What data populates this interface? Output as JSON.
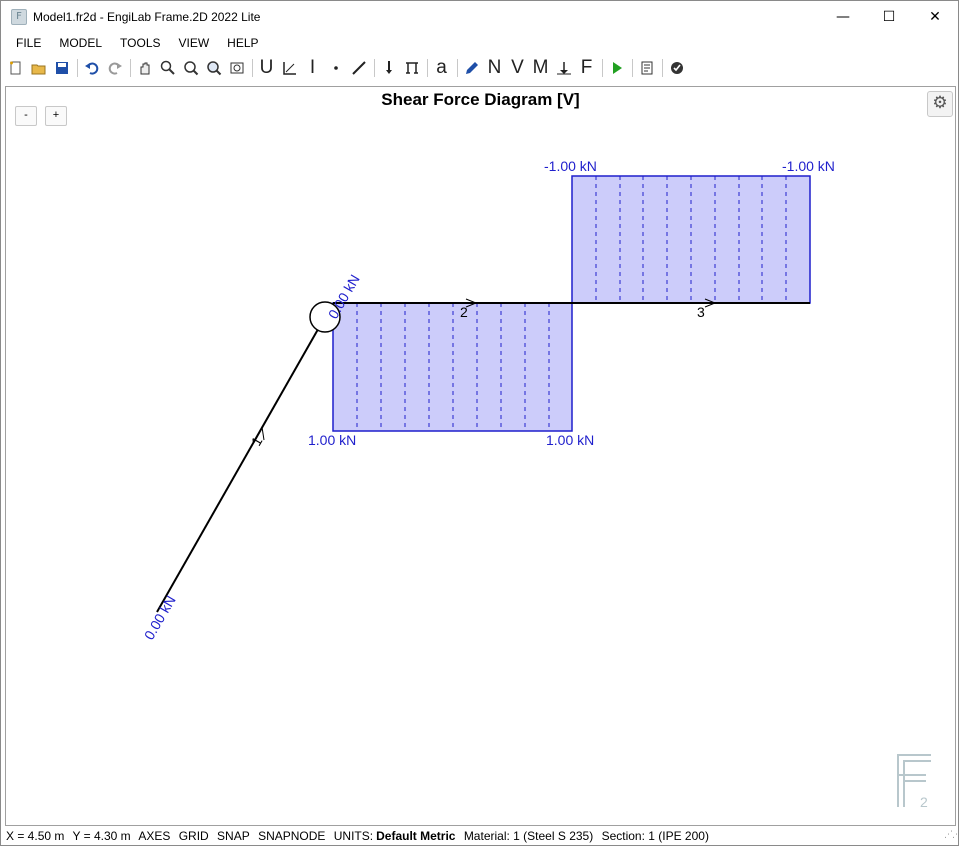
{
  "window": {
    "title": "Model1.fr2d - EngiLab Frame.2D 2022 Lite",
    "app_icon": "F",
    "minimize": "—",
    "maximize": "☐",
    "close": "✕"
  },
  "menu": [
    "FILE",
    "MODEL",
    "TOOLS",
    "VIEW",
    "HELP"
  ],
  "toolbar": {
    "icons": [
      "new-file-icon",
      "open-folder-icon",
      "save-icon",
      "undo-icon",
      "redo-icon",
      "pan-icon",
      "zoom-in-icon",
      "zoom-extents-icon",
      "zoom-window-icon",
      "zoom-previous-icon",
      "units-icon",
      "axes-icon",
      "section-icon",
      "node-icon",
      "line-icon",
      "load-icon",
      "support-icon",
      "label-icon",
      "pencil-icon",
      "axial-force-icon",
      "shear-force-icon",
      "bending-moment-icon",
      "reactions-icon",
      "forces-icon",
      "run-icon",
      "report-icon",
      "check-icon"
    ],
    "glyphs": {
      "units": "U",
      "section": "I",
      "label": "a",
      "axial": "N",
      "shear": "V",
      "moment": "M",
      "forces": "F"
    }
  },
  "canvas": {
    "title": "Shear Force Diagram [V]",
    "zoom_out": "-",
    "zoom_in": "+",
    "settings": "⚙"
  },
  "diagram": {
    "fill_color": "#ccccfa",
    "stroke_color": "#1f1fcc",
    "member_color": "#000000",
    "members": [
      {
        "id": "1",
        "label": "1"
      },
      {
        "id": "2",
        "label": "2"
      },
      {
        "id": "3",
        "label": "3"
      }
    ],
    "labels": {
      "m1_start": "0.00 kN",
      "m1_end": "0.00 kN",
      "m2_start": "1.00 kN",
      "m2_end": "1.00 kN",
      "m3_start": "-1.00 kN",
      "m3_end": "-1.00 kN"
    },
    "shear_values": [
      {
        "member": "1",
        "start": 0.0,
        "end": 0.0
      },
      {
        "member": "2",
        "start": 1.0,
        "end": 1.0
      },
      {
        "member": "3",
        "start": -1.0,
        "end": -1.0
      }
    ]
  },
  "status": {
    "x": "X = 4.50 m",
    "y": "Y = 4.30 m",
    "axes": "AXES",
    "grid": "GRID",
    "snap": "SNAP",
    "snapnode": "SNAPNODE",
    "units_label": "UNITS:",
    "units_value": "Default Metric",
    "material": "Material: 1 (Steel S 235)",
    "section": "Section: 1 (IPE 200)"
  }
}
